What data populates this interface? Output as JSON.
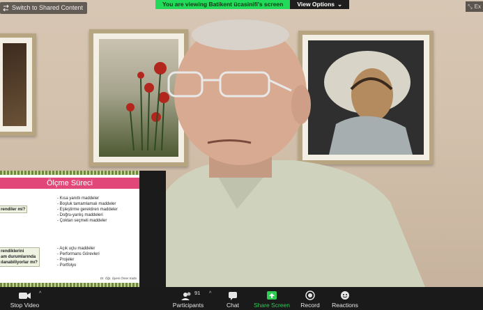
{
  "top_bar": {
    "switch_label": "Switch to Shared Content",
    "viewing_banner": "You are viewing Batikent ücasinifi's screen",
    "view_options_label": "View Options",
    "exit_label": "Ex"
  },
  "slide": {
    "title": "Ölçme Süreci",
    "left_labels": [
      "rendiler mi?",
      "rendiklerini",
      "am durumlarında",
      "ılanabiliyorlar mı?"
    ],
    "list_top": [
      "- Kısa yanıtlı maddeler",
      "- Boşluk tamamlamalı maddeler",
      "- Eşleştirme gerektiren maddeler",
      "- Doğru-yanlış maddeleri",
      "- Çoktan seçmeli maddeler"
    ],
    "list_bottom": [
      "- Açık uçlu maddeler",
      "- Performans Görevleri",
      "- Projeler",
      "- Portfolyo"
    ],
    "signature": "Dr. Öğr. Üyesi Ömer Kutlu"
  },
  "toolbar": {
    "stop_video": "Stop Video",
    "participants": "Participants",
    "participants_count": "91",
    "chat": "Chat",
    "share_screen": "Share Screen",
    "record": "Record",
    "reactions": "Reactions"
  },
  "colors": {
    "banner_green": "#23d959",
    "share_green": "#2ecc54",
    "slide_title_pink": "#e2477a",
    "toolbar_bg": "#1a1a1a"
  }
}
